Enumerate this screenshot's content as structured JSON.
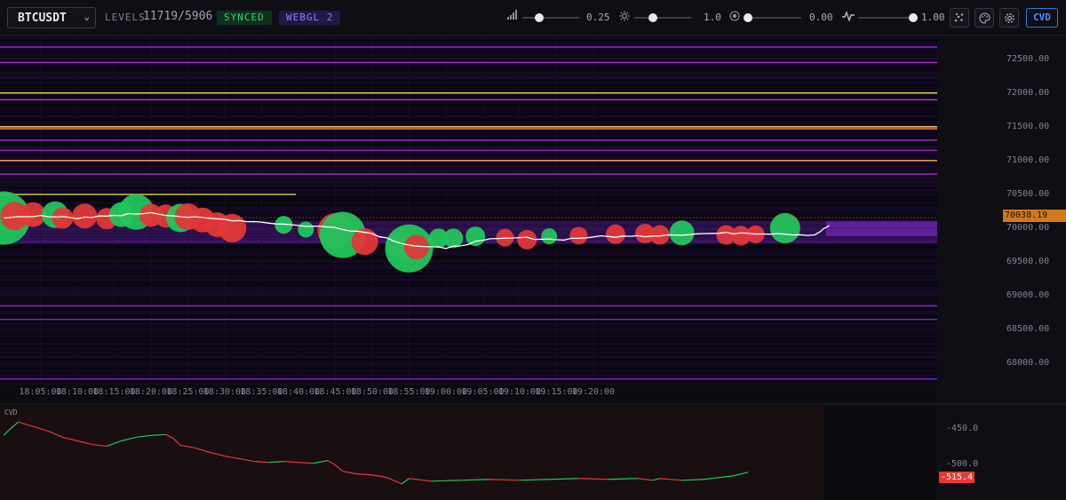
{
  "toolbar": {
    "symbol": "BTCUSDT",
    "levels_label": "LEVELS",
    "levels_value": "11719/5906",
    "synced_badge": "SYNCED",
    "webgl_badge": "WEBGL 2",
    "sliders": [
      {
        "icon": "signal-bars-icon",
        "value_text": "0.25",
        "level": 0.25
      },
      {
        "icon": "brightness-icon",
        "value_text": "1.0",
        "level": 0.3
      },
      {
        "icon": "radius-icon",
        "value_text": "0.00",
        "level": 0.0
      },
      {
        "icon": "pulse-icon",
        "value_text": "1.00",
        "level": 1.0
      }
    ],
    "cvd_button": "CVD"
  },
  "colors": {
    "buy": "#22c55e",
    "sell": "#e0383a",
    "price_line": "#ffffff",
    "liquidity": "#8a2be2",
    "price_tag": "#d17a18",
    "cvd_tag": "#e53935"
  },
  "chart_data": [
    {
      "type": "scatter",
      "y_ticks": [
        "72500.00",
        "72000.00",
        "71500.00",
        "71000.00",
        "70500.00",
        "70000.00",
        "69500.00",
        "69000.00",
        "68500.00",
        "68000.00"
      ],
      "x_ticks": [
        "18:05:00",
        "18:10:00",
        "18:15:00",
        "18:20:00",
        "18:25:00",
        "18:30:00",
        "18:35:00",
        "18:40:00",
        "18:45:00",
        "18:50:00",
        "18:55:00",
        "19:00:00",
        "19:05:00",
        "19:10:00",
        "19:15:00",
        "19:20:00"
      ],
      "ylim": [
        67700,
        72850
      ],
      "last_price": "70038.19",
      "level_lines": [
        {
          "price": 72000,
          "color": "#f2e66b"
        },
        {
          "price": 71500,
          "color": "#ffc58a"
        },
        {
          "price": 71470,
          "color": "#ff8a3a"
        },
        {
          "price": 71000,
          "color": "#ffb04a"
        },
        {
          "price": 70500,
          "color": "#c9c24a"
        },
        {
          "price": 72450,
          "color": "#b33cc8"
        },
        {
          "price": 72680,
          "color": "#a032d8"
        },
        {
          "price": 71900,
          "color": "#b838c0"
        },
        {
          "price": 71300,
          "color": "#a83ad0"
        },
        {
          "price": 71150,
          "color": "#9a34c4"
        },
        {
          "price": 70800,
          "color": "#a235c8"
        },
        {
          "price": 68850,
          "color": "#8a2fc8"
        },
        {
          "price": 68650,
          "color": "#7e2cc0"
        },
        {
          "price": 67770,
          "color": "#7a2cbe"
        }
      ],
      "price_series": [
        [
          0,
          70150
        ],
        [
          5,
          70190
        ],
        [
          10,
          70140
        ],
        [
          15,
          70190
        ],
        [
          20,
          70230
        ],
        [
          25,
          70160
        ],
        [
          30,
          70130
        ],
        [
          35,
          70090
        ],
        [
          40,
          70040
        ],
        [
          45,
          70010
        ],
        [
          50,
          69920
        ],
        [
          55,
          69750
        ],
        [
          60,
          69700
        ],
        [
          65,
          69820
        ],
        [
          70,
          69860
        ],
        [
          75,
          69830
        ],
        [
          80,
          69870
        ],
        [
          85,
          69880
        ],
        [
          90,
          69900
        ],
        [
          95,
          69920
        ],
        [
          100,
          69930
        ],
        [
          105,
          69920
        ],
        [
          110,
          69900
        ],
        [
          112,
          70040
        ]
      ],
      "trade_bubbles": [
        {
          "t": 0,
          "p": 70150,
          "s": "buy",
          "r": 30
        },
        {
          "t": 1.5,
          "p": 70180,
          "s": "sell",
          "r": 16
        },
        {
          "t": 4,
          "p": 70200,
          "s": "sell",
          "r": 14
        },
        {
          "t": 7,
          "p": 70200,
          "s": "buy",
          "r": 15
        },
        {
          "t": 8,
          "p": 70150,
          "s": "sell",
          "r": 12
        },
        {
          "t": 11,
          "p": 70180,
          "s": "sell",
          "r": 14
        },
        {
          "t": 14,
          "p": 70140,
          "s": "sell",
          "r": 12
        },
        {
          "t": 16,
          "p": 70200,
          "s": "buy",
          "r": 14
        },
        {
          "t": 18,
          "p": 70240,
          "s": "buy",
          "r": 20
        },
        {
          "t": 20,
          "p": 70190,
          "s": "sell",
          "r": 13
        },
        {
          "t": 22,
          "p": 70180,
          "s": "sell",
          "r": 13
        },
        {
          "t": 24,
          "p": 70150,
          "s": "buy",
          "r": 16
        },
        {
          "t": 25,
          "p": 70170,
          "s": "sell",
          "r": 15
        },
        {
          "t": 27,
          "p": 70120,
          "s": "sell",
          "r": 14
        },
        {
          "t": 29,
          "p": 70050,
          "s": "sell",
          "r": 14
        },
        {
          "t": 31,
          "p": 70000,
          "s": "sell",
          "r": 16
        },
        {
          "t": 38,
          "p": 70050,
          "s": "buy",
          "r": 10
        },
        {
          "t": 41,
          "p": 69980,
          "s": "buy",
          "r": 9
        },
        {
          "t": 45,
          "p": 69960,
          "s": "sell",
          "r": 20
        },
        {
          "t": 46,
          "p": 69900,
          "s": "buy",
          "r": 26
        },
        {
          "t": 49,
          "p": 69800,
          "s": "sell",
          "r": 15
        },
        {
          "t": 54,
          "p": 69740,
          "s": "sell",
          "r": 16
        },
        {
          "t": 55,
          "p": 69700,
          "s": "buy",
          "r": 27
        },
        {
          "t": 56,
          "p": 69720,
          "s": "sell",
          "r": 14
        },
        {
          "t": 59,
          "p": 69850,
          "s": "buy",
          "r": 11
        },
        {
          "t": 61,
          "p": 69850,
          "s": "buy",
          "r": 11
        },
        {
          "t": 64,
          "p": 69880,
          "s": "buy",
          "r": 11
        },
        {
          "t": 68,
          "p": 69860,
          "s": "sell",
          "r": 10
        },
        {
          "t": 71,
          "p": 69830,
          "s": "sell",
          "r": 11
        },
        {
          "t": 74,
          "p": 69880,
          "s": "buy",
          "r": 9
        },
        {
          "t": 78,
          "p": 69890,
          "s": "sell",
          "r": 10
        },
        {
          "t": 83,
          "p": 69910,
          "s": "sell",
          "r": 11
        },
        {
          "t": 87,
          "p": 69920,
          "s": "sell",
          "r": 11
        },
        {
          "t": 89,
          "p": 69900,
          "s": "sell",
          "r": 11
        },
        {
          "t": 92,
          "p": 69930,
          "s": "buy",
          "r": 14
        },
        {
          "t": 98,
          "p": 69900,
          "s": "sell",
          "r": 11
        },
        {
          "t": 100,
          "p": 69890,
          "s": "sell",
          "r": 11
        },
        {
          "t": 102,
          "p": 69910,
          "s": "sell",
          "r": 10
        },
        {
          "t": 106,
          "p": 70000,
          "s": "buy",
          "r": 17
        }
      ]
    },
    {
      "type": "line",
      "title": "CVD",
      "y_ticks": [
        "-450.0",
        "-500.0"
      ],
      "ylim": [
        -540,
        -435
      ],
      "last_value": "-515.4",
      "series": [
        {
          "values": [
            [
              0,
              -468
            ],
            [
              1,
              -460
            ],
            [
              2,
              -453
            ],
            [
              4,
              -458
            ],
            [
              6,
              -463
            ],
            [
              8,
              -470
            ],
            [
              10,
              -474
            ],
            [
              12,
              -478
            ],
            [
              14,
              -480
            ],
            [
              16,
              -474
            ],
            [
              18,
              -470
            ],
            [
              20,
              -468
            ],
            [
              22,
              -467
            ],
            [
              23,
              -471
            ],
            [
              24,
              -479
            ],
            [
              26,
              -482
            ],
            [
              28,
              -487
            ],
            [
              30,
              -491
            ],
            [
              32,
              -494
            ],
            [
              34,
              -497
            ],
            [
              36,
              -498
            ],
            [
              38,
              -497
            ],
            [
              40,
              -498
            ],
            [
              42,
              -499
            ],
            [
              44,
              -496
            ],
            [
              45,
              -501
            ],
            [
              46,
              -508
            ],
            [
              48,
              -511
            ],
            [
              50,
              -512
            ],
            [
              52,
              -515
            ],
            [
              54,
              -522
            ],
            [
              55,
              -516
            ],
            [
              58,
              -519
            ],
            [
              62,
              -518
            ],
            [
              66,
              -517
            ],
            [
              70,
              -518
            ],
            [
              74,
              -517
            ],
            [
              78,
              -516
            ],
            [
              82,
              -517
            ],
            [
              86,
              -516
            ],
            [
              88,
              -518
            ],
            [
              89,
              -516
            ],
            [
              92,
              -518
            ],
            [
              95,
              -517
            ],
            [
              99,
              -513
            ],
            [
              101,
              -509
            ]
          ]
        }
      ]
    }
  ]
}
